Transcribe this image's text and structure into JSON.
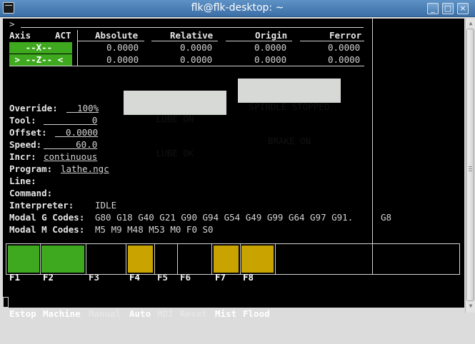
{
  "window": {
    "title": "flk@flk-desktop: ~"
  },
  "prompt": ">",
  "dro": {
    "headers": [
      "Axis",
      "ACT",
      "Absolute",
      "Relative",
      "Origin",
      "Ferror"
    ],
    "rows": [
      {
        "axis": "   --X--   ",
        "absolute": "0.0000",
        "relative": "0.0000",
        "origin": "0.0000",
        "ferror": "0.0000"
      },
      {
        "axis": " > --Z-- < ",
        "absolute": "0.0000",
        "relative": "0.0000",
        "origin": "0.0000",
        "ferror": "0.0000"
      }
    ]
  },
  "status": {
    "spindle": "SPINDLE STOPPED",
    "brake": "BRAKE ON",
    "lube_on": "LUBE ON",
    "lube_ok": "LUBE OK"
  },
  "info": {
    "override_label": "Override:",
    "override_value": "  100%",
    "tool_label": "Tool:",
    "tool_value": "         0",
    "offset_label": "Offset:",
    "offset_value": "  0.0000",
    "speed_label": "Speed:",
    "speed_value": "      60.0",
    "incr_label": "Incr:",
    "incr_value": "continuous",
    "program_label": "Program:",
    "program_value": "lathe.ngc",
    "line_label": "Line:",
    "command_label": "Command:",
    "interpreter_label": "Interpreter:",
    "interpreter_value": "IDLE",
    "gcodes_label": "Modal G Codes:",
    "gcodes_value": "G80 G18 G40 G21 G90 G94 G54 G49 G99 G64 G97 G91.",
    "gcodes_overflow": "G8",
    "mcodes_label": "Modal M Codes:",
    "mcodes_value": "M5 M9 M48 M53 M0 F0 S0"
  },
  "function_keys": [
    {
      "key": "F1",
      "label": "Estop",
      "color": "#3ea81e"
    },
    {
      "key": "F2",
      "label": "Machine",
      "color": "#3ea81e"
    },
    {
      "key": "F3",
      "label": "Manual",
      "color": ""
    },
    {
      "key": "F4",
      "label": "Auto",
      "color": "#c9a400"
    },
    {
      "key": "F5",
      "label": "MDI",
      "color": ""
    },
    {
      "key": "F6",
      "label": "Reset",
      "color": ""
    },
    {
      "key": "F7",
      "label": "Mist",
      "color": "#c9a400"
    },
    {
      "key": "F8",
      "label": "Flood",
      "color": "#c9a400"
    }
  ],
  "colors": {
    "terminal_bg": "#000000",
    "terminal_fg": "#d3d3d3",
    "active_green": "#3ea81e",
    "warn_yellow": "#c9a400",
    "titlebar_blue": "#3a6ea5"
  }
}
